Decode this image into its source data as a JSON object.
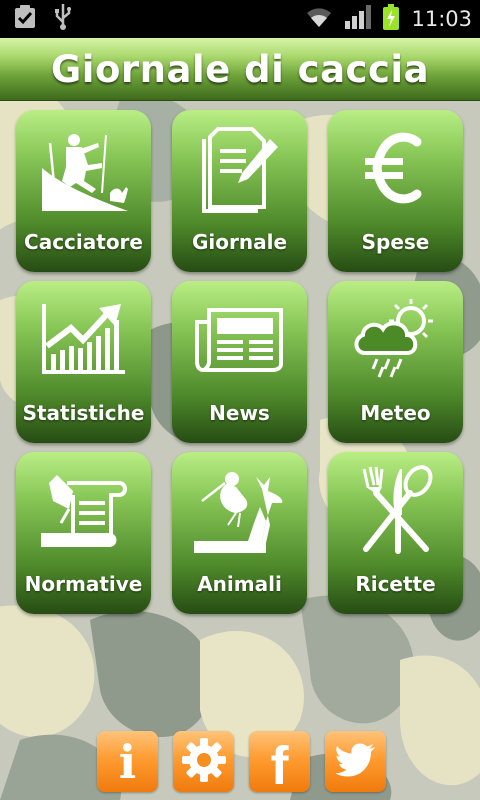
{
  "status_bar": {
    "time": "11:03",
    "left_icons": [
      "clipboard-check-icon",
      "usb-icon"
    ],
    "right_icons": [
      "wifi-icon",
      "signal-icon",
      "battery-charging-icon"
    ]
  },
  "header": {
    "title": "Giornale di caccia"
  },
  "tiles": [
    {
      "label": "Cacciatore",
      "icon": "hunter-icon"
    },
    {
      "label": "Giornale",
      "icon": "notepad-pencil-icon"
    },
    {
      "label": "Spese",
      "icon": "euro-icon"
    },
    {
      "label": "Statistiche",
      "icon": "chart-arrow-icon"
    },
    {
      "label": "News",
      "icon": "newspaper-icon"
    },
    {
      "label": "Meteo",
      "icon": "weather-icon"
    },
    {
      "label": "Normative",
      "icon": "scroll-pen-icon"
    },
    {
      "label": "Animali",
      "icon": "animals-icon"
    },
    {
      "label": "Ricette",
      "icon": "cutlery-icon"
    }
  ],
  "bottom_buttons": [
    {
      "name": "info",
      "glyph": "i",
      "icon": "info-icon"
    },
    {
      "name": "settings",
      "icon": "gear-icon"
    },
    {
      "name": "facebook",
      "glyph": "f",
      "icon": "facebook-icon"
    },
    {
      "name": "twitter",
      "icon": "twitter-bird-icon"
    }
  ],
  "colors": {
    "tile_top": "#b9ee84",
    "tile_bottom": "#264c13",
    "button_orange": "#ff9c31",
    "camo_light": "#e9e6c6",
    "camo_mid": "#b9bdb0",
    "camo_dark": "#8f9a8c"
  }
}
